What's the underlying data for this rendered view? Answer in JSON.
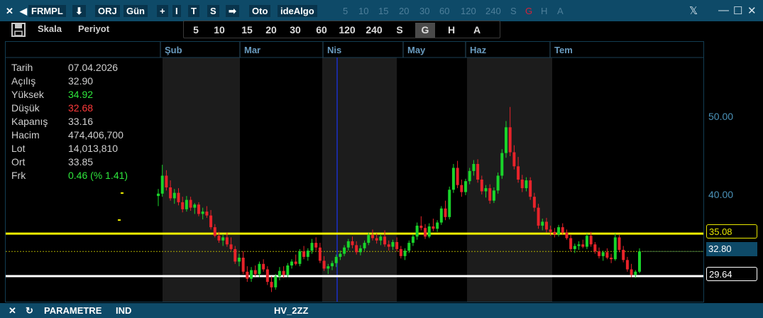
{
  "titlebar": {
    "close": "✕",
    "back_arrow": "◀",
    "symbol": "FRMPL",
    "download": "⬇",
    "orj": "ORJ",
    "period": "Gün",
    "plus": "+",
    "i": "I",
    "t": "T",
    "s": "S",
    "forward_arrow": "➡",
    "oto": "Oto",
    "idealgo": "ideAlgo",
    "periods_dim": [
      "5",
      "10",
      "15",
      "20",
      "30",
      "60",
      "120",
      "240",
      "S",
      "G",
      "H",
      "A"
    ],
    "active_dim": "G",
    "x_logo": "𝕏",
    "minimize": "—",
    "maximize": "☐",
    "window_close": "✕"
  },
  "toolbar": {
    "save_icon": "save-icon",
    "skala": "Skala",
    "periyot": "Periyot",
    "periods": [
      "5",
      "10",
      "15",
      "20",
      "30",
      "60",
      "120",
      "240",
      "S",
      "G",
      "H",
      "A"
    ],
    "selected": "G"
  },
  "months": [
    "Şub",
    "Mar",
    "Nis",
    "May",
    "Haz",
    "Tem"
  ],
  "info": {
    "rows": [
      {
        "key": "Tarih",
        "value": "07.04.2026",
        "color": "#cfcfcf"
      },
      {
        "key": "Açılış",
        "value": "32.90",
        "color": "#cfcfcf"
      },
      {
        "key": "Yüksek",
        "value": "34.92",
        "color": "#2ee63c"
      },
      {
        "key": "Düşük",
        "value": "32.68",
        "color": "#ff3a3a"
      },
      {
        "key": "Kapanış",
        "value": "33.16",
        "color": "#cfcfcf"
      },
      {
        "key": "Hacim",
        "value": "474,406,700",
        "color": "#cfcfcf"
      },
      {
        "key": "Lot",
        "value": "14,013,810",
        "color": "#cfcfcf"
      },
      {
        "key": "Ort",
        "value": "33.85",
        "color": "#cfcfcf"
      },
      {
        "key": "Frk",
        "value": "0.46 (% 1.41)",
        "color": "#2ee63c"
      }
    ]
  },
  "axis": {
    "labels": [
      "50.00",
      "40.00"
    ],
    "level_yellow": "35.08",
    "current_price": "32.80",
    "level_white": "29.64"
  },
  "bottombar": {
    "close": "✕",
    "refresh": "↻",
    "parametre": "PARAMETRE",
    "ind": "IND",
    "hv": "HV_2ZZ"
  },
  "chart_data": {
    "type": "candlestick",
    "x_months": [
      "Şub",
      "Mar",
      "Nis",
      "May",
      "Haz",
      "Tem"
    ],
    "y_ticks": [
      40,
      50
    ],
    "horizontal_levels": [
      35.08,
      29.64
    ],
    "last_price": 32.8,
    "candles": [
      [
        39.9,
        40.8,
        38.6,
        40.2
      ],
      [
        40.2,
        43.9,
        39.8,
        42.5
      ],
      [
        42.5,
        43.2,
        40.6,
        41.0
      ],
      [
        41.0,
        41.9,
        39.3,
        39.6
      ],
      [
        39.6,
        40.8,
        38.9,
        40.3
      ],
      [
        40.3,
        40.9,
        38.7,
        39.1
      ],
      [
        39.1,
        39.8,
        37.8,
        38.2
      ],
      [
        38.2,
        39.9,
        37.9,
        39.4
      ],
      [
        39.4,
        39.8,
        38.0,
        38.4
      ],
      [
        38.4,
        39.0,
        37.6,
        38.8
      ],
      [
        38.8,
        39.1,
        37.3,
        37.6
      ],
      [
        37.6,
        38.4,
        36.9,
        37.9
      ],
      [
        37.9,
        38.6,
        37.1,
        37.4
      ],
      [
        37.4,
        38.1,
        35.6,
        35.9
      ],
      [
        35.9,
        36.3,
        34.6,
        34.8
      ],
      [
        34.8,
        35.3,
        33.9,
        34.2
      ],
      [
        34.2,
        35.0,
        33.5,
        34.6
      ],
      [
        34.6,
        35.2,
        33.4,
        33.7
      ],
      [
        33.7,
        34.6,
        32.9,
        33.1
      ],
      [
        33.1,
        33.5,
        31.2,
        31.5
      ],
      [
        31.5,
        32.5,
        30.9,
        32.0
      ],
      [
        32.0,
        32.8,
        29.9,
        30.2
      ],
      [
        30.2,
        30.9,
        28.9,
        29.3
      ],
      [
        29.3,
        30.8,
        28.9,
        30.4
      ],
      [
        30.4,
        31.0,
        29.6,
        29.9
      ],
      [
        29.9,
        31.5,
        29.5,
        31.2
      ],
      [
        31.2,
        31.8,
        30.2,
        30.5
      ],
      [
        30.5,
        30.9,
        28.5,
        28.9
      ],
      [
        28.9,
        29.6,
        27.6,
        28.2
      ],
      [
        28.2,
        29.9,
        27.9,
        29.6
      ],
      [
        29.6,
        30.8,
        29.1,
        30.3
      ],
      [
        30.3,
        30.9,
        29.4,
        29.8
      ],
      [
        29.8,
        31.3,
        29.5,
        31.0
      ],
      [
        31.0,
        31.8,
        30.6,
        31.5
      ],
      [
        31.5,
        32.4,
        31.0,
        31.2
      ],
      [
        31.2,
        33.1,
        30.9,
        32.8
      ],
      [
        32.8,
        33.5,
        31.8,
        32.1
      ],
      [
        32.1,
        33.2,
        31.6,
        32.9
      ],
      [
        32.9,
        34.4,
        32.5,
        33.9
      ],
      [
        33.9,
        34.6,
        32.9,
        33.3
      ],
      [
        33.3,
        33.9,
        31.3,
        31.6
      ],
      [
        31.6,
        32.2,
        30.3,
        30.6
      ],
      [
        30.6,
        31.2,
        29.9,
        30.9
      ],
      [
        30.9,
        31.6,
        30.4,
        31.3
      ],
      [
        31.3,
        32.4,
        30.8,
        32.1
      ],
      [
        32.1,
        32.9,
        31.7,
        32.5
      ],
      [
        32.5,
        33.6,
        32.2,
        33.3
      ],
      [
        33.3,
        34.4,
        32.9,
        34.1
      ],
      [
        34.1,
        34.7,
        33.2,
        33.6
      ],
      [
        33.6,
        34.1,
        32.4,
        32.7
      ],
      [
        32.7,
        33.6,
        32.3,
        33.2
      ],
      [
        33.2,
        34.2,
        32.9,
        33.9
      ],
      [
        33.9,
        35.2,
        33.6,
        34.9
      ],
      [
        34.9,
        35.6,
        34.2,
        34.5
      ],
      [
        34.5,
        35.1,
        33.8,
        34.2
      ],
      [
        34.2,
        35.0,
        33.6,
        34.7
      ],
      [
        34.7,
        35.5,
        33.4,
        33.7
      ],
      [
        33.7,
        34.2,
        32.9,
        33.4
      ],
      [
        33.4,
        34.3,
        33.0,
        34.0
      ],
      [
        34.0,
        34.6,
        32.8,
        33.1
      ],
      [
        33.1,
        33.5,
        31.9,
        32.2
      ],
      [
        32.2,
        33.2,
        31.7,
        32.9
      ],
      [
        32.9,
        34.2,
        32.6,
        33.9
      ],
      [
        33.9,
        35.0,
        33.5,
        34.7
      ],
      [
        34.7,
        36.5,
        34.3,
        36.1
      ],
      [
        36.1,
        37.3,
        35.5,
        35.8
      ],
      [
        35.8,
        36.3,
        34.4,
        34.7
      ],
      [
        34.7,
        36.4,
        34.5,
        36.0
      ],
      [
        36.0,
        37.0,
        35.4,
        35.7
      ],
      [
        35.7,
        36.8,
        35.3,
        36.5
      ],
      [
        36.5,
        38.6,
        36.2,
        38.3
      ],
      [
        38.3,
        39.3,
        36.8,
        37.2
      ],
      [
        37.2,
        41.1,
        36.9,
        40.7
      ],
      [
        40.7,
        44.0,
        40.3,
        43.5
      ],
      [
        43.5,
        44.4,
        40.9,
        41.3
      ],
      [
        41.3,
        42.0,
        39.8,
        40.4
      ],
      [
        40.4,
        42.1,
        40.0,
        41.8
      ],
      [
        41.8,
        43.5,
        41.4,
        43.1
      ],
      [
        43.1,
        44.5,
        42.5,
        44.0
      ],
      [
        44.0,
        44.6,
        41.6,
        42.0
      ],
      [
        42.0,
        42.5,
        40.1,
        40.5
      ],
      [
        40.5,
        41.3,
        39.7,
        40.9
      ],
      [
        40.9,
        41.4,
        38.9,
        39.3
      ],
      [
        39.3,
        41.0,
        39.0,
        40.6
      ],
      [
        40.6,
        42.9,
        40.2,
        42.5
      ],
      [
        42.5,
        45.9,
        42.1,
        45.4
      ],
      [
        45.4,
        49.5,
        44.8,
        48.7
      ],
      [
        48.7,
        51.3,
        45.0,
        45.5
      ],
      [
        45.5,
        46.4,
        43.3,
        43.7
      ],
      [
        43.7,
        44.9,
        41.6,
        42.0
      ],
      [
        42.0,
        42.6,
        40.4,
        40.9
      ],
      [
        40.9,
        42.3,
        40.5,
        41.9
      ],
      [
        41.9,
        42.3,
        39.4,
        39.8
      ],
      [
        39.8,
        40.3,
        37.9,
        38.4
      ],
      [
        38.4,
        38.9,
        35.7,
        36.1
      ],
      [
        36.1,
        37.0,
        35.5,
        36.6
      ],
      [
        36.6,
        37.1,
        35.2,
        35.6
      ],
      [
        35.6,
        36.1,
        34.8,
        35.3
      ],
      [
        35.3,
        35.8,
        34.6,
        35.0
      ],
      [
        35.0,
        36.2,
        34.7,
        35.9
      ],
      [
        35.9,
        36.4,
        34.9,
        35.2
      ],
      [
        35.2,
        35.6,
        34.3,
        34.5
      ],
      [
        34.5,
        34.9,
        32.8,
        33.1
      ],
      [
        33.1,
        33.8,
        32.6,
        33.5
      ],
      [
        33.5,
        34.1,
        33.0,
        33.7
      ],
      [
        33.7,
        34.3,
        33.2,
        33.4
      ],
      [
        33.4,
        35.1,
        33.1,
        34.8
      ],
      [
        34.8,
        35.3,
        33.4,
        33.7
      ],
      [
        33.7,
        34.0,
        32.5,
        32.8
      ],
      [
        32.8,
        33.3,
        31.9,
        32.2
      ],
      [
        32.2,
        32.9,
        31.6,
        32.7
      ],
      [
        32.7,
        33.2,
        31.8,
        32.0
      ],
      [
        32.0,
        32.5,
        31.3,
        31.8
      ],
      [
        31.8,
        35.1,
        31.6,
        34.6
      ],
      [
        34.6,
        34.9,
        32.7,
        33.0
      ],
      [
        33.0,
        33.5,
        31.4,
        31.7
      ],
      [
        31.7,
        32.1,
        30.2,
        30.5
      ],
      [
        30.5,
        31.2,
        29.5,
        29.8
      ],
      [
        29.8,
        30.4,
        29.4,
        30.2
      ],
      [
        30.2,
        33.2,
        30.0,
        32.8
      ]
    ]
  }
}
